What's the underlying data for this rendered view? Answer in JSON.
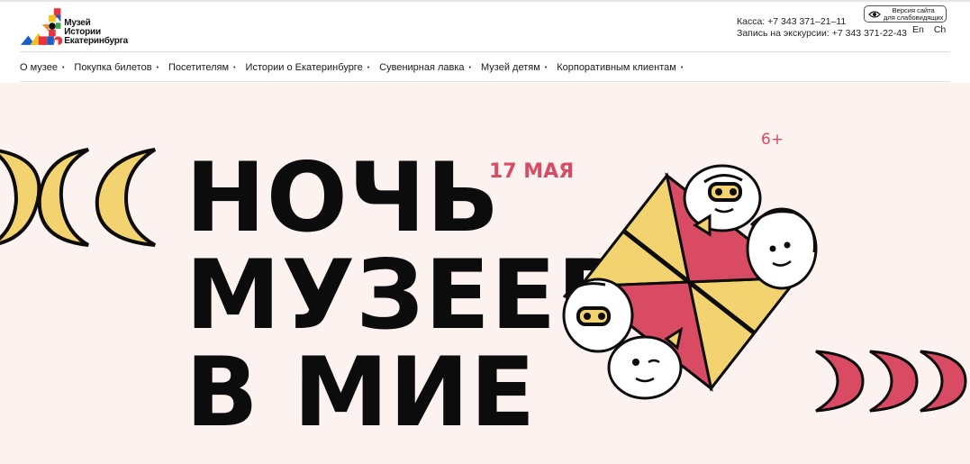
{
  "logo": {
    "lines": [
      "Музей",
      "Истории",
      "Екатеринбурга"
    ],
    "icon": "museum-logo-icon"
  },
  "contacts": {
    "cashier": "Касса: +7 343 371–21–11",
    "tours": "Запись на экскурсии: +7 343 371-22-43"
  },
  "accessibility": {
    "line1": "Версия сайта",
    "line2": "для слабовидящих",
    "icon": "eye-icon"
  },
  "langs": [
    "En",
    "Ch"
  ],
  "nav": [
    {
      "label": "О музее"
    },
    {
      "label": "Покупка билетов"
    },
    {
      "label": "Посетителям"
    },
    {
      "label": "Истории о Екатеринбурге"
    },
    {
      "label": "Сувенирная лавка"
    },
    {
      "label": "Музей детям"
    },
    {
      "label": "Корпоративным клиентам"
    }
  ],
  "hero": {
    "title_lines": [
      "НОЧЬ",
      "МУЗЕЕВ",
      "В МИЕ"
    ],
    "date": "17 МАЯ",
    "age": "6+",
    "colors": {
      "background": "#fcf3f0",
      "accent": "#d94a63",
      "yellow": "#f2d36f",
      "black": "#0c0c0c"
    }
  }
}
